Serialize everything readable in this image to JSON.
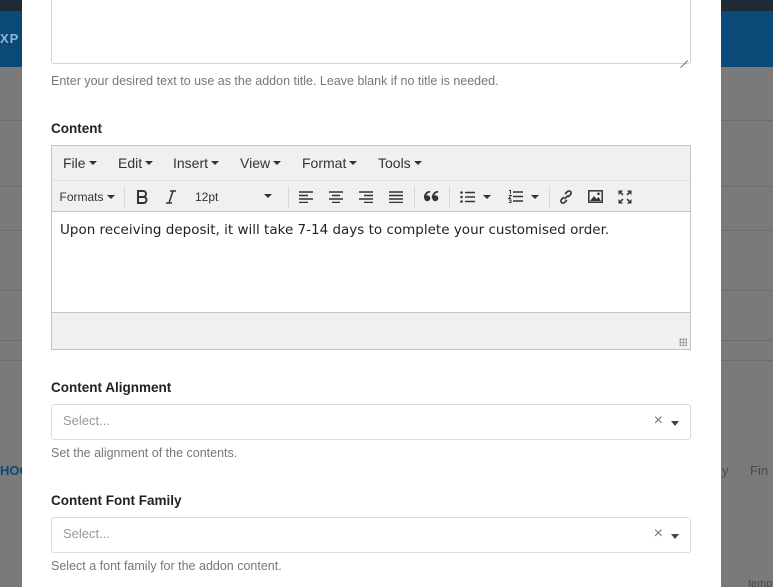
{
  "background": {
    "header_text": "XP",
    "side_texts": [
      "HOC",
      "y",
      "Fin",
      "temp"
    ]
  },
  "title_field": {
    "help": "Enter your desired text to use as the addon title. Leave blank if no title is needed."
  },
  "content_field": {
    "label": "Content",
    "menu": [
      "File",
      "Edit",
      "Insert",
      "View",
      "Format",
      "Tools"
    ],
    "toolbar": {
      "formats_label": "Formats",
      "font_size": "12pt"
    },
    "body_text": "Upon receiving deposit, it will take 7-14 days to complete your customised order."
  },
  "alignment_field": {
    "label": "Content Alignment",
    "placeholder": "Select...",
    "clear": "×",
    "help": "Set the alignment of the contents."
  },
  "font_family_field": {
    "label": "Content Font Family",
    "placeholder": "Select...",
    "clear": "×",
    "help": "Select a font family for the addon content."
  },
  "colors": {
    "header": "#0b4a78",
    "topbar": "#1e2a36",
    "editor_chrome": "#f0f0f0"
  },
  "icons": [
    "bold-icon",
    "italic-icon",
    "align-left-icon",
    "align-center-icon",
    "align-right-icon",
    "align-justify-icon",
    "blockquote-icon",
    "bullet-list-icon",
    "numbered-list-icon",
    "link-icon",
    "image-icon",
    "fullscreen-icon"
  ]
}
